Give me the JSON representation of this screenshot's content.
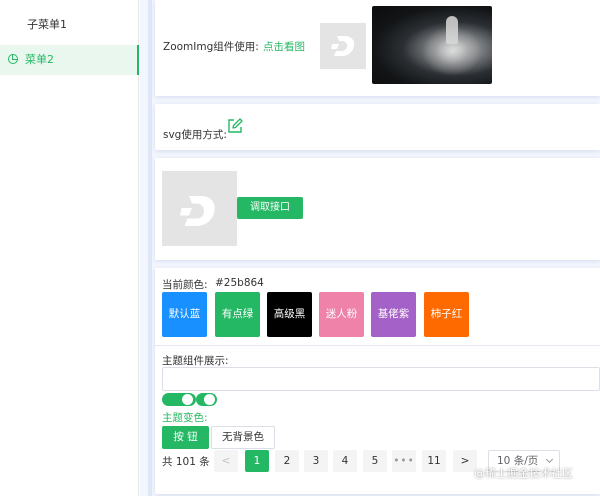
{
  "sidebar": {
    "submenu_label": "子菜单1",
    "active_item_label": "菜单2",
    "accent": "#25b864"
  },
  "zoom_card": {
    "label": "ZoomImg组件使用:",
    "link": "点击看图"
  },
  "svg_card": {
    "label": "svg使用方式:"
  },
  "api_card": {
    "button": "调取接口"
  },
  "theme_card": {
    "current_color_label": "当前颜色:",
    "current_color_value": "#25b864",
    "colors": [
      {
        "label": "默认蓝",
        "color": "#1890ff"
      },
      {
        "label": "有点绿",
        "color": "#25b864"
      },
      {
        "label": "高级黑",
        "color": "#000000"
      },
      {
        "label": "迷人粉",
        "color": "#ee82a8"
      },
      {
        "label": "基佬紫",
        "color": "#a461c7"
      },
      {
        "label": "柿子红",
        "color": "#ff6a00"
      }
    ],
    "component_label": "主题组件展示:",
    "input_value": "",
    "switch_on": true,
    "switch_off": false,
    "theme_change_label": "主题变色:",
    "primary_button": "按 钮",
    "plain_button": "无背景色"
  },
  "pagination": {
    "total": "共 101 条",
    "prev": "<",
    "pages": [
      "1",
      "2",
      "3",
      "4",
      "5"
    ],
    "ellipsis": "•••",
    "last": "11",
    "next": ">",
    "current": "1",
    "page_size": "10 条/页"
  },
  "watermark": "@稀土掘金技术社区"
}
